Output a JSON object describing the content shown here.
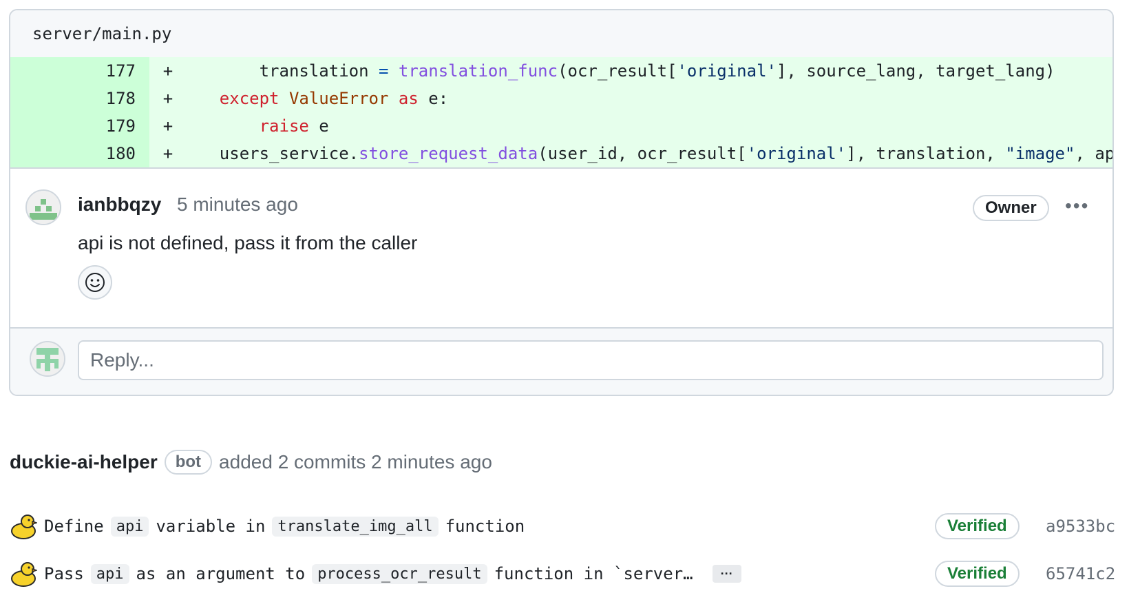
{
  "file": {
    "path": "server/main.py"
  },
  "diff": {
    "lines": [
      {
        "num": "177",
        "marker": "+"
      },
      {
        "num": "178",
        "marker": "+"
      },
      {
        "num": "179",
        "marker": "+"
      },
      {
        "num": "180",
        "marker": "+"
      }
    ],
    "tokens": {
      "l177": [
        "        translation ",
        "=",
        " ",
        "translation_func",
        "(ocr_result[",
        "'original'",
        "], source_lang, target_lang)"
      ],
      "l178": [
        "    ",
        "except",
        " ",
        "ValueError",
        " ",
        "as",
        " e:"
      ],
      "l179": [
        "        ",
        "raise",
        " e"
      ],
      "l180": [
        "    users_service.",
        "store_request_data",
        "(user_id, ocr_result[",
        "'original'",
        "], translation, ",
        "\"image\"",
        ", ap"
      ]
    }
  },
  "comment": {
    "author": "ianbbqzy",
    "time": "5 minutes ago",
    "role_badge": "Owner",
    "menu_glyph": "•••",
    "body": "api is not defined, pass it from the caller"
  },
  "reply": {
    "placeholder": "Reply..."
  },
  "event": {
    "actor": "duckie-ai-helper",
    "badge": "bot",
    "text": "added 2 commits 2 minutes ago"
  },
  "commits": [
    {
      "parts": [
        "Define",
        "api",
        "variable in",
        "translate_img_all",
        "function"
      ],
      "status": "Verified",
      "sha": "a9533bc"
    },
    {
      "parts": [
        "Pass",
        "api",
        "as an argument to",
        "process_ocr_result",
        "function in `server…"
      ],
      "more": "···",
      "status": "Verified",
      "sha": "65741c2"
    }
  ],
  "colors": {
    "added_bg": "#e6ffec",
    "added_num_bg": "#ccffd8",
    "verified": "#1a7f37",
    "keyword": "#cf222e",
    "function": "#8250df",
    "string": "#0a3069"
  }
}
